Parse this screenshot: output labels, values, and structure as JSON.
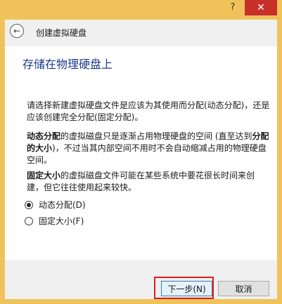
{
  "titlebar": {
    "help_label": "?",
    "close_label": "✕"
  },
  "header": {
    "back_icon": "back-arrow-icon",
    "back_glyph": "←",
    "title": "创建虚拟硬盘"
  },
  "content": {
    "main_title": "存储在物理硬盘上",
    "para1": "请选择新建虚拟硬盘文件是应该为其使用而分配(动态分配)，还是应该创建完全分配(固定分配)。",
    "para2_bold1": "动态分配",
    "para2_text1": "的虚拟磁盘只是逐渐占用物理硬盘的空间 (直至达到",
    "para2_bold2": "分配的大小",
    "para2_text2": ")，不过当其内部空间不用时不会自动缩减占用的物理硬盘空间。",
    "para3_bold": "固定大小",
    "para3_text": "的虚拟磁盘文件可能在某些系统中要花很长时间来创建，但它往往使用起来较快。",
    "options": [
      {
        "label": "动态分配(D)",
        "selected": true
      },
      {
        "label": "固定大小(F)",
        "selected": false
      }
    ]
  },
  "footer": {
    "next_label": "下一步(N)",
    "cancel_label": "取消"
  },
  "colors": {
    "title_blue": "#1f3a8a",
    "close_red": "#c8302a",
    "frame": "#f0c35a",
    "highlight_red": "#d81e1e"
  }
}
